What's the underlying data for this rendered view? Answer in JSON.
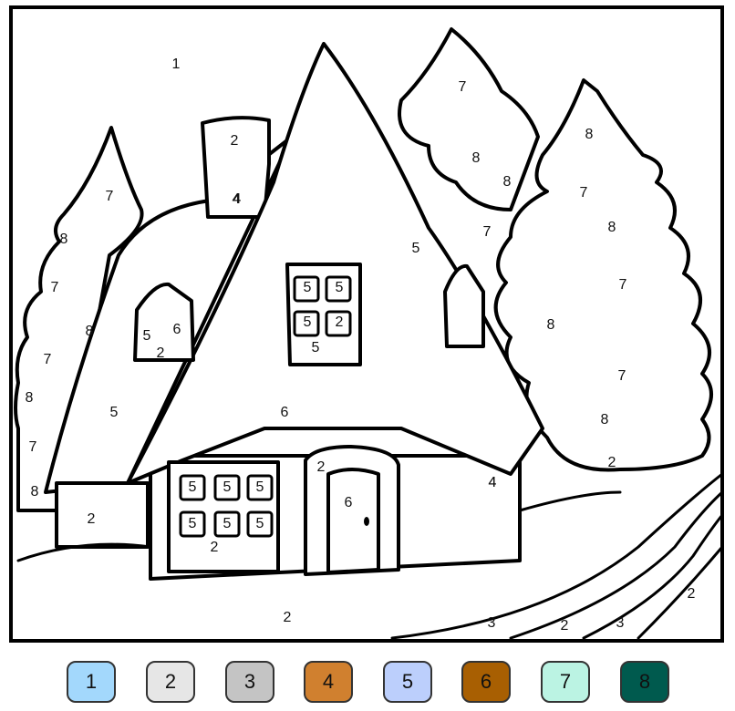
{
  "picture": {
    "region_labels": [
      "1",
      "2",
      "4",
      "7",
      "8",
      "7",
      "8",
      "7",
      "8",
      "7",
      "8",
      "7",
      "8",
      "8",
      "7",
      "8",
      "7",
      "8",
      "7",
      "8",
      "7",
      "8",
      "2",
      "5",
      "5",
      "5",
      "5",
      "2",
      "5",
      "6",
      "2",
      "5",
      "5",
      "6",
      "2",
      "4",
      "4",
      "5",
      "5",
      "5",
      "5",
      "5",
      "5",
      "2",
      "2",
      "6",
      "4",
      "2",
      "3",
      "2",
      "3",
      "2"
    ]
  },
  "palette": [
    {
      "number": "1",
      "color": "#a3d8fc"
    },
    {
      "number": "2",
      "color": "#e6e6e6"
    },
    {
      "number": "3",
      "color": "#c4c4c4"
    },
    {
      "number": "4",
      "color": "#d0802f"
    },
    {
      "number": "5",
      "color": "#bccffc"
    },
    {
      "number": "6",
      "color": "#a85f02"
    },
    {
      "number": "7",
      "color": "#bbf3e3"
    },
    {
      "number": "8",
      "color": "#005a4e"
    }
  ]
}
